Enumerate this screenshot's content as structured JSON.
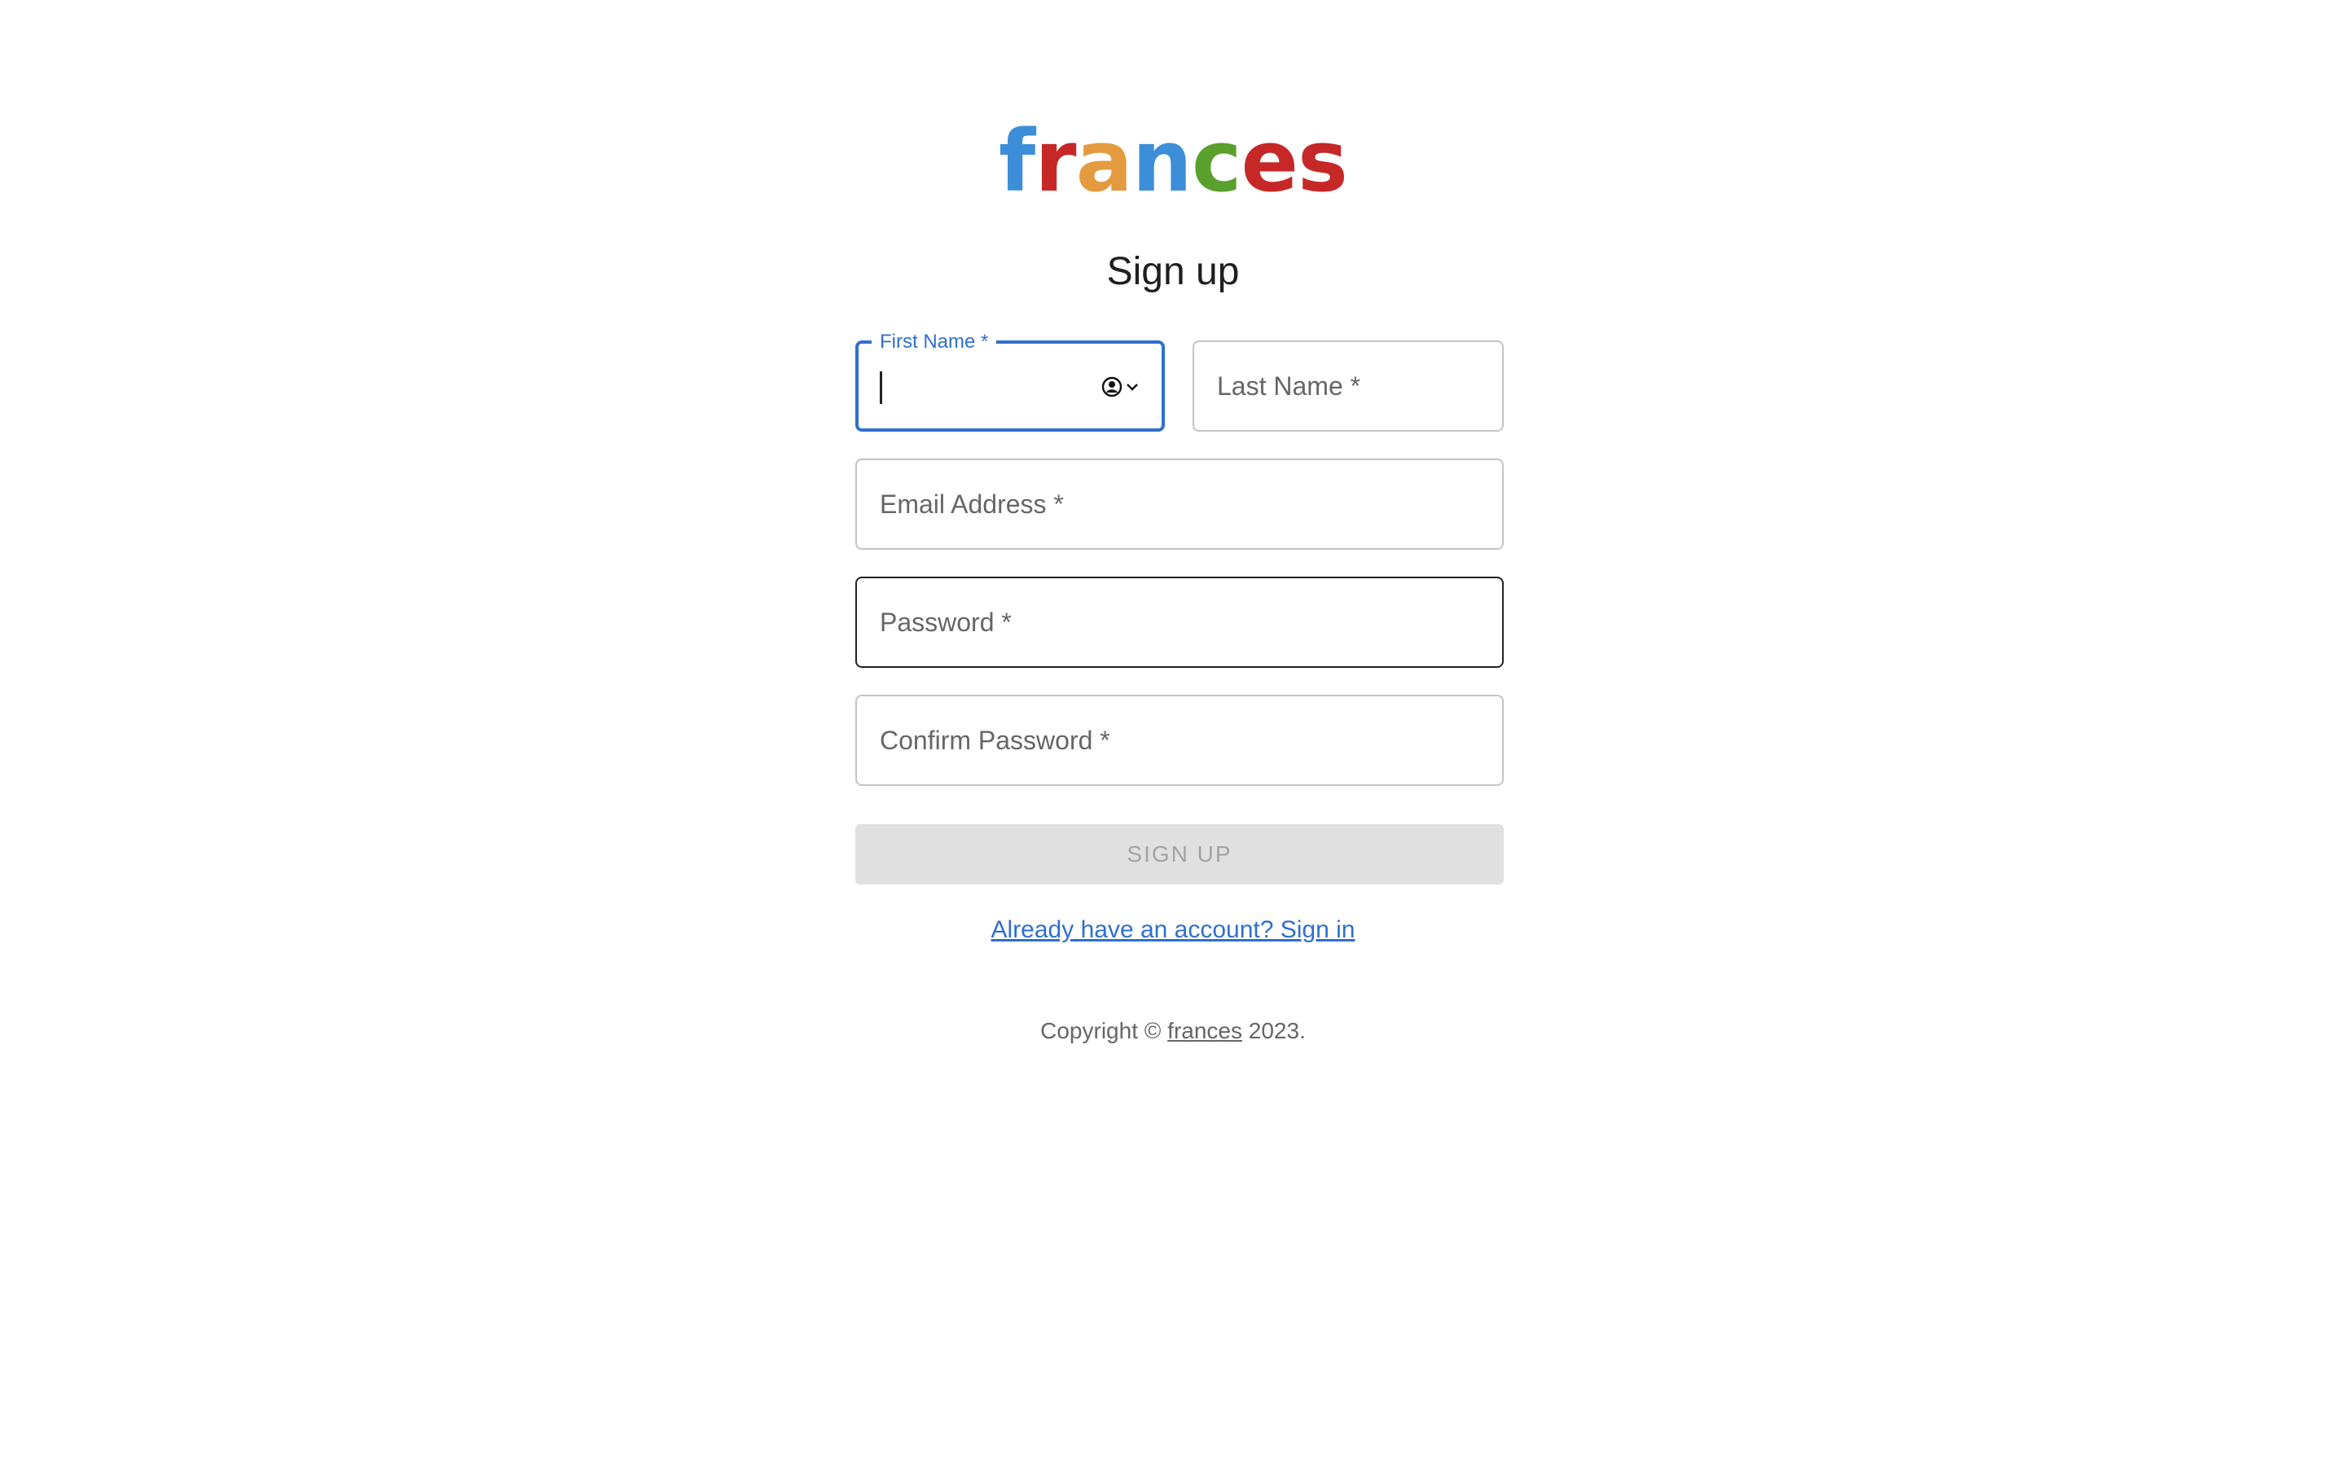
{
  "brand": {
    "letters": [
      {
        "char": "f",
        "color": "#3d8ed8"
      },
      {
        "char": "r",
        "color": "#c62828"
      },
      {
        "char": "a",
        "color": "#e49a3e"
      },
      {
        "char": "n",
        "color": "#3d8ed8"
      },
      {
        "char": "c",
        "color": "#5aa02c"
      },
      {
        "char": "e",
        "color": "#c62828"
      },
      {
        "char": "s",
        "color": "#c62828"
      }
    ]
  },
  "form": {
    "title": "Sign up",
    "first_name": {
      "label": "First Name *",
      "value": ""
    },
    "last_name": {
      "placeholder": "Last Name *"
    },
    "email": {
      "placeholder": "Email Address *"
    },
    "password": {
      "placeholder": "Password *"
    },
    "confirm_password": {
      "placeholder": "Confirm Password *"
    },
    "submit_label": "SIGN UP",
    "signin_link": "Already have an account? Sign in"
  },
  "footer": {
    "prefix": "Copyright © ",
    "brand": "frances",
    "suffix": " 2023."
  },
  "colors": {
    "accent": "#2f6fcf",
    "disabled_button": "#e0e0e0"
  },
  "icons": {
    "autofill": "contact-autofill-icon"
  }
}
